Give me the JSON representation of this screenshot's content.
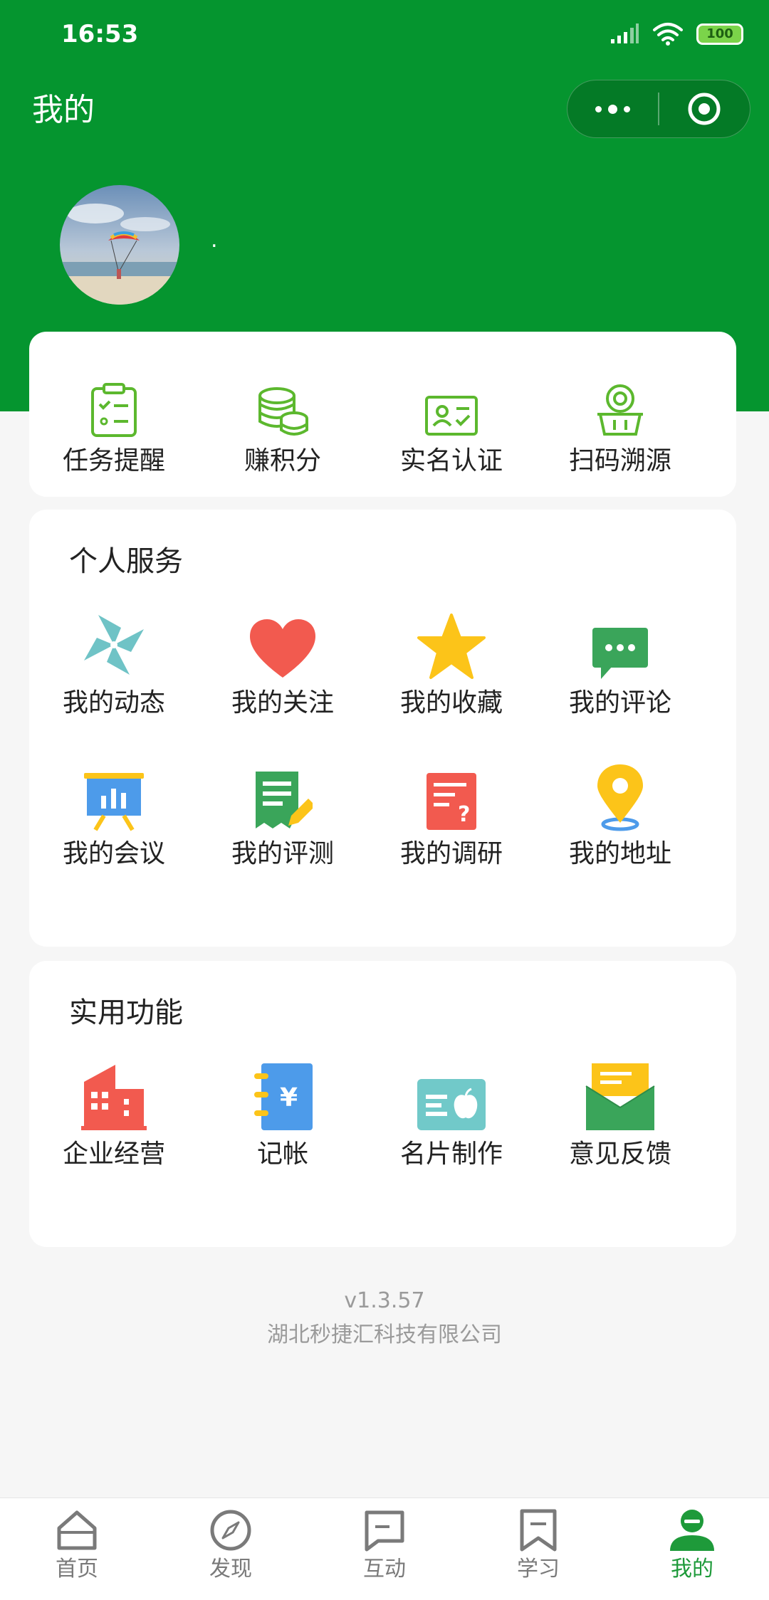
{
  "status_bar": {
    "time": "16:53",
    "battery": "100"
  },
  "header": {
    "title": "我的"
  },
  "capsule": {
    "more_icon": "more-dots-icon",
    "close_icon": "target-circle-icon"
  },
  "profile": {
    "name": "."
  },
  "quick_actions": [
    {
      "label": "任务提醒",
      "icon": "clipboard-checklist-icon"
    },
    {
      "label": "赚积分",
      "icon": "coins-stack-icon"
    },
    {
      "label": "实名认证",
      "icon": "id-card-check-icon"
    },
    {
      "label": "扫码溯源",
      "icon": "scan-basket-icon"
    }
  ],
  "personal_services": {
    "title": "个人服务",
    "items": [
      {
        "label": "我的动态",
        "icon": "pinwheel-icon"
      },
      {
        "label": "我的关注",
        "icon": "heart-icon"
      },
      {
        "label": "我的收藏",
        "icon": "star-icon"
      },
      {
        "label": "我的评论",
        "icon": "chat-bubble-icon"
      },
      {
        "label": "我的会议",
        "icon": "presentation-board-icon"
      },
      {
        "label": "我的评测",
        "icon": "document-pen-icon"
      },
      {
        "label": "我的调研",
        "icon": "survey-question-icon"
      },
      {
        "label": "我的地址",
        "icon": "location-pin-icon"
      }
    ]
  },
  "practical_functions": {
    "title": "实用功能",
    "items": [
      {
        "label": "企业经营",
        "icon": "building-icon"
      },
      {
        "label": "记帐",
        "icon": "yen-notebook-icon"
      },
      {
        "label": "名片制作",
        "icon": "business-card-icon"
      },
      {
        "label": "意见反馈",
        "icon": "envelope-icon"
      }
    ]
  },
  "footer": {
    "version": "v1.3.57",
    "company": "湖北秒捷汇科技有限公司"
  },
  "tabbar": [
    {
      "label": "首页",
      "icon": "home-icon",
      "active": false
    },
    {
      "label": "发现",
      "icon": "compass-icon",
      "active": false
    },
    {
      "label": "互动",
      "icon": "message-square-icon",
      "active": false
    },
    {
      "label": "学习",
      "icon": "bookmark-icon",
      "active": false
    },
    {
      "label": "我的",
      "icon": "user-profile-icon",
      "active": true
    }
  ],
  "colors": {
    "brand_green": "#05952f",
    "active_tab": "#1e9a3a",
    "background": "#f6f6f6"
  }
}
